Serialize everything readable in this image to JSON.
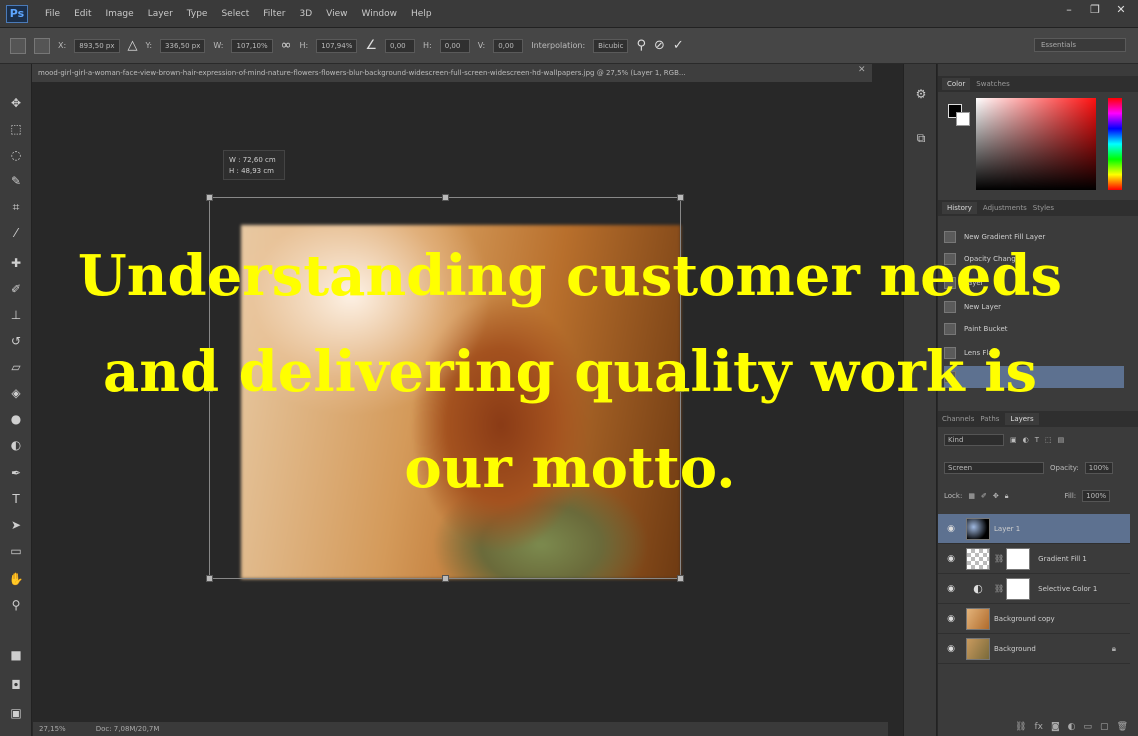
{
  "app": {
    "logo": "Ps",
    "menu": [
      "File",
      "Edit",
      "Image",
      "Layer",
      "Type",
      "Select",
      "Filter",
      "3D",
      "View",
      "Window",
      "Help"
    ],
    "window_controls": [
      "–",
      "❐",
      "✕"
    ]
  },
  "options_bar": {
    "x_label": "X:",
    "x_value": "893,50 px",
    "y_label": "Y:",
    "y_value": "336,50 px",
    "w_label": "W:",
    "w_value": "107,10%",
    "h_label": "H:",
    "h_value": "107,94%",
    "angle_value": "0,00",
    "hskew_label": "H:",
    "hskew_value": "0,00",
    "vskew_label": "V:",
    "vskew_value": "0,00",
    "interpolation_label": "Interpolation:",
    "interpolation_value": "Bicubic",
    "workspace": "Essentials"
  },
  "document": {
    "tab_title": "mood-girl-girl-a-woman-face-view-brown-hair-expression-of-mind-nature-flowers-flowers-blur-background-widescreen-full-screen-widescreen-hd-wallpapers.jpg @ 27,5% (Layer 1, RGB...",
    "measure_w": "W : 72,60 cm",
    "measure_h": "H : 48,93 cm"
  },
  "status_bar": {
    "zoom": "27,15%",
    "doc": "Doc: 7,08M/20,7M"
  },
  "panels": {
    "color_tabs": [
      "Color",
      "Swatches"
    ],
    "history_tabs": [
      "History",
      "Adjustments",
      "Styles"
    ],
    "history_items": [
      "New Gradient Fill Layer",
      "Opacity Change",
      "Layer",
      "New Layer",
      "Paint Bucket",
      "Lens Flare"
    ],
    "layers_tabs": [
      "Channels",
      "Paths",
      "Layers"
    ],
    "kind_label": "Kind",
    "blend_mode": "Screen",
    "opacity_label": "Opacity:",
    "opacity_value": "100%",
    "lock_label": "Lock:",
    "fill_label": "Fill:",
    "fill_value": "100%",
    "layers": [
      {
        "name": "Layer 1",
        "selected": true
      },
      {
        "name": "Gradient Fill 1",
        "selected": false
      },
      {
        "name": "Selective Color 1",
        "selected": false
      },
      {
        "name": "Background copy",
        "selected": false
      },
      {
        "name": "Background",
        "selected": false
      }
    ]
  },
  "overlay": {
    "caption": "Understanding customer needs and delivering quality work is our motto."
  },
  "colors": {
    "caption": "#ffff00",
    "selection": "#5d7190"
  }
}
